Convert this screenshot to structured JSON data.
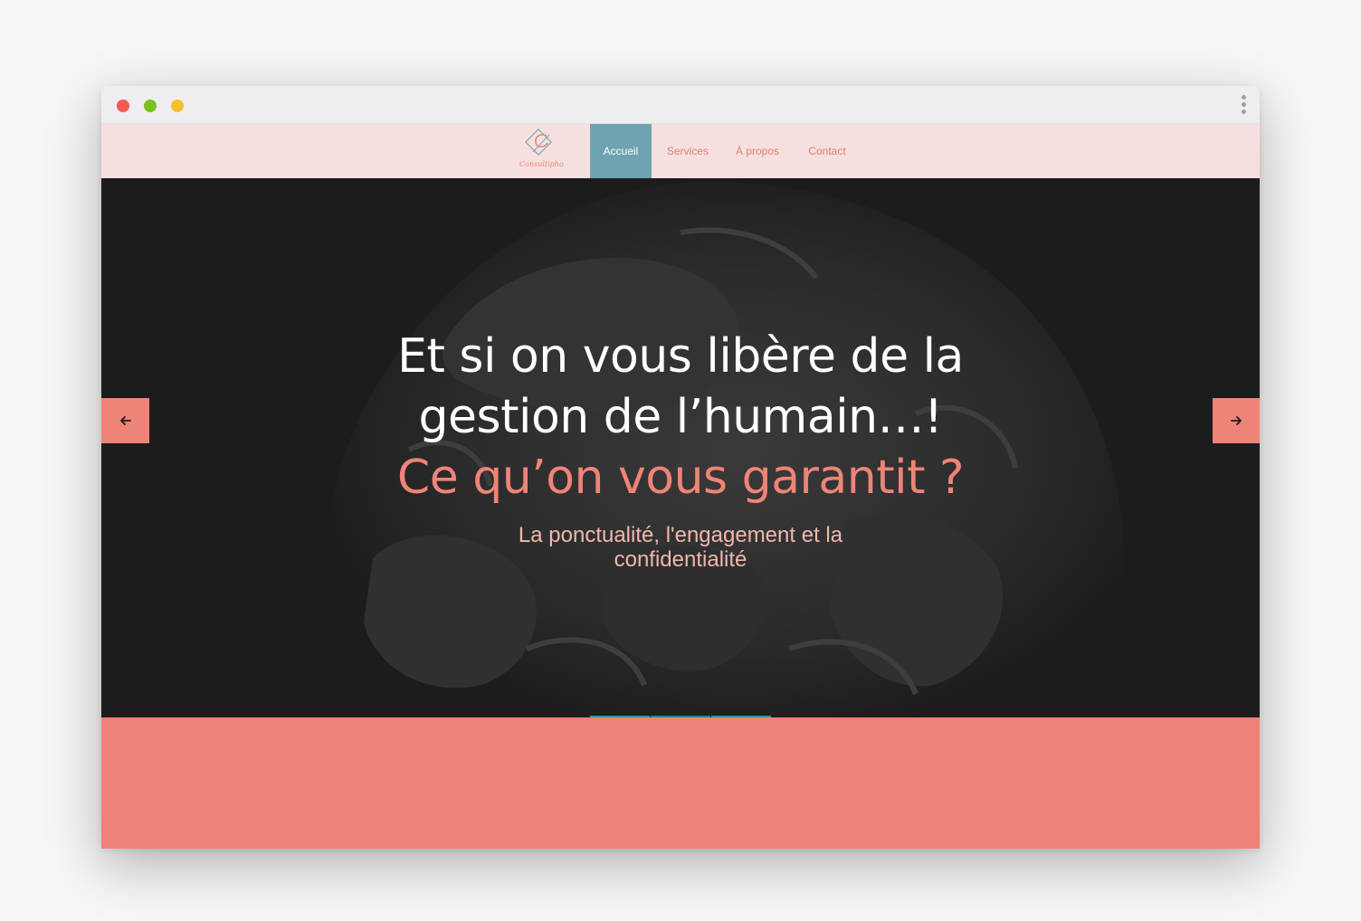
{
  "brand": {
    "logo_letter": "C",
    "logo_word": "Consultipho",
    "color_pink": "#f6e0df",
    "color_coral": "#ee8477",
    "color_teal": "#6fa3b1"
  },
  "nav": {
    "items": [
      {
        "label": "Accueil",
        "active": true
      },
      {
        "label": "Services",
        "active": false
      },
      {
        "label": "À propos",
        "active": false
      },
      {
        "label": "Contact",
        "active": false
      }
    ]
  },
  "hero": {
    "headline_line1": "Et si on vous libère de la",
    "headline_line2": "gestion de l’humain…!",
    "headline_accent": "Ce qu’on vous garantit ?",
    "subline_line1": "La ponctualité, l'engagement et la",
    "subline_line2": "confidentialité",
    "prev_icon": "arrow-left-icon",
    "next_icon": "arrow-right-icon",
    "slide_count": 3,
    "active_slide": 2
  }
}
